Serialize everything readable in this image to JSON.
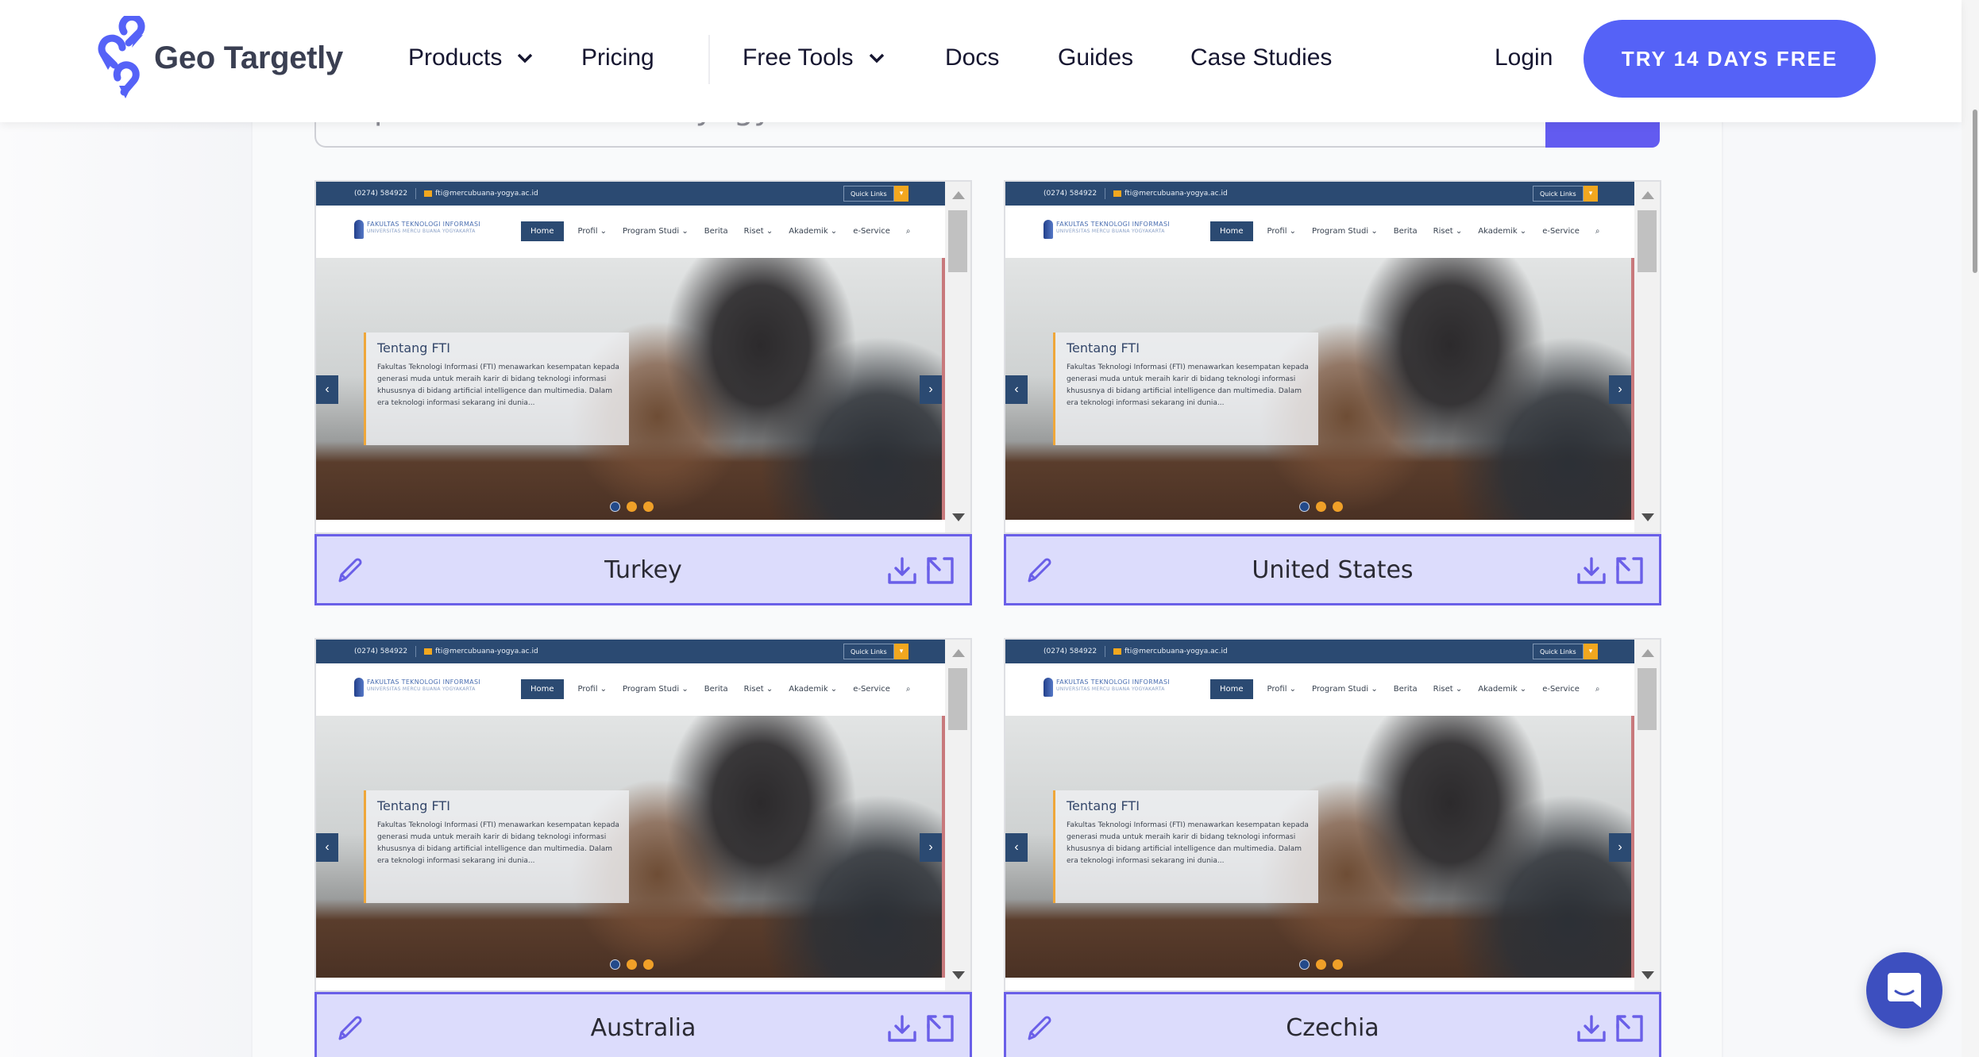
{
  "header": {
    "brand": "Geo Targetly",
    "nav": [
      {
        "label": "Products",
        "has_dropdown": true
      },
      {
        "label": "Pricing",
        "has_dropdown": false
      },
      {
        "label": "Free Tools",
        "has_dropdown": true
      },
      {
        "label": "Docs",
        "has_dropdown": false
      },
      {
        "label": "Guides",
        "has_dropdown": false
      },
      {
        "label": "Case Studies",
        "has_dropdown": false
      }
    ],
    "login_label": "Login",
    "cta_label": "TRY 14 DAYS FREE"
  },
  "url_input": {
    "value": "https://fti.mercubuana-yogya.ac.id/"
  },
  "preview_site": {
    "phone": "(0274) 584922",
    "email": "fti@mercubuana-yogya.ac.id",
    "quick_links": "Quick Links",
    "logo_title": "FAKULTAS TEKNOLOGI INFORMASI",
    "logo_subtitle": "UNIVERSITAS MERCU BUANA YOGYAKARTA",
    "nav": [
      "Home",
      "Profil ⌄",
      "Program Studi ⌄",
      "Berita",
      "Riset ⌄",
      "Akademik ⌄",
      "e-Service",
      "⌕"
    ],
    "slide_title": "Tentang FTI",
    "slide_body": "Fakultas Teknologi Informasi (FTI) menawarkan kesempatan kepada generasi muda untuk meraih karir di bidang teknologi informasi khususnya di bidang artificial intelligence dan multimedia. Dalam era teknologi informasi sekarang ini dunia...",
    "prev_arrow": "‹",
    "next_arrow": "›",
    "slide_count": 3,
    "active_slide": 1
  },
  "results": [
    {
      "country": "Turkey"
    },
    {
      "country": "United States"
    },
    {
      "country": "Australia"
    },
    {
      "country": "Czechia"
    }
  ],
  "icons": {
    "edit": "pencil-icon",
    "download": "download-icon",
    "expand": "expand-icon",
    "chat": "chat-icon"
  },
  "colors": {
    "brand": "#5562f7",
    "accent_border": "#6a5fe8",
    "card_footer_bg": "#dcdcfc",
    "site_navy": "#2b4a72",
    "site_orange": "#f0a028",
    "chat": "#3d4fbf"
  }
}
